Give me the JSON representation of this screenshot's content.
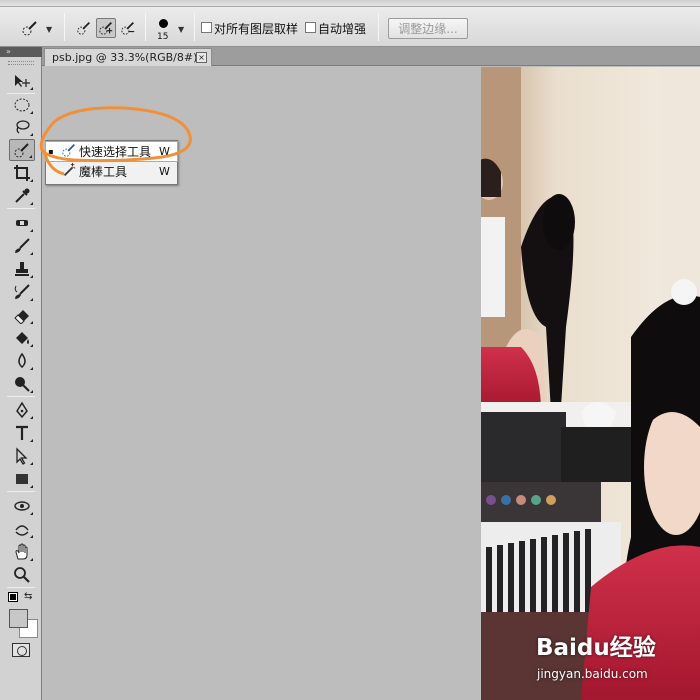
{
  "menu": {
    "items": [
      "",
      "",
      "",
      "",
      "",
      "",
      ""
    ]
  },
  "options_bar": {
    "brush_size": "15",
    "sample_all_layers_label": "对所有图层取样",
    "auto_enhance_label": "自动增强",
    "refine_edge_label": "调整边缘..."
  },
  "document": {
    "tab_title": "psb.jpg @ 33.3%(RGB/8#)",
    "close_glyph": "×"
  },
  "tools_panel": {
    "header_glyph": "»"
  },
  "flyout": {
    "items": [
      {
        "bullet": "▪",
        "label": "快速选择工具",
        "shortcut": "W",
        "icon": "quick-selection-icon",
        "selected": true
      },
      {
        "bullet": "",
        "label": "魔棒工具",
        "shortcut": "W",
        "icon": "magic-wand-icon",
        "selected": false
      }
    ]
  },
  "colors": {
    "annotation_circle": "#f0903a",
    "canvas_bg": "#bdbdbd",
    "panel_bg": "#d2d2d2"
  },
  "watermark": {
    "logo": "Baidu经验",
    "url": "jingyan.baidu.com"
  }
}
